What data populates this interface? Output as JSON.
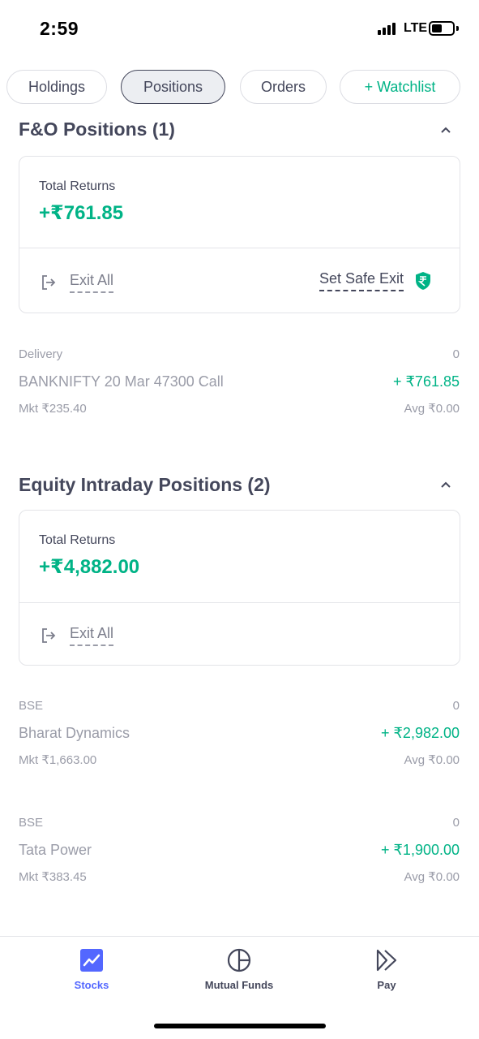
{
  "status_bar": {
    "time": "2:59",
    "network": "LTE"
  },
  "tabs": [
    {
      "label": "Holdings"
    },
    {
      "label": "Positions",
      "active": true
    },
    {
      "label": "Orders"
    },
    {
      "label": "+ Watchlist"
    }
  ],
  "fno": {
    "title": "F&O Positions (1)",
    "total_returns_label": "Total Returns",
    "total_returns_value": "+₹761.85",
    "exit_all_label": "Exit All",
    "safe_exit_label": "Set Safe Exit",
    "positions": [
      {
        "segment": "Delivery",
        "qty": "0",
        "name": "BANKNIFTY 20 Mar 47300 Call",
        "pl": "+ ₹761.85",
        "mkt": "Mkt ₹235.40",
        "avg": "Avg ₹0.00"
      }
    ]
  },
  "equity": {
    "title": "Equity Intraday Positions (2)",
    "total_returns_label": "Total Returns",
    "total_returns_value": "+₹4,882.00",
    "exit_all_label": "Exit All",
    "positions": [
      {
        "segment": "BSE",
        "qty": "0",
        "name": "Bharat Dynamics",
        "pl": "+ ₹2,982.00",
        "mkt": "Mkt ₹1,663.00",
        "avg": "Avg ₹0.00"
      },
      {
        "segment": "BSE",
        "qty": "0",
        "name": "Tata Power",
        "pl": "+ ₹1,900.00",
        "mkt": "Mkt ₹383.45",
        "avg": "Avg ₹0.00"
      }
    ]
  },
  "bottom_nav": [
    {
      "label": "Stocks",
      "icon": "stocks-chart-icon",
      "active": true
    },
    {
      "label": "Mutual Funds",
      "icon": "pie-chart-icon"
    },
    {
      "label": "Pay",
      "icon": "pay-arrows-icon"
    }
  ],
  "colors": {
    "accent_green": "#00b386",
    "accent_blue": "#5367ff",
    "text_primary": "#44475b",
    "text_muted": "#9a9ca8"
  }
}
